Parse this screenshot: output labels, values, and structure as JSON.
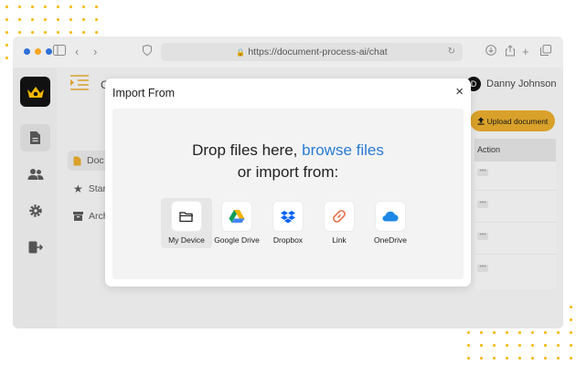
{
  "browser": {
    "url": "https://document-process-ai/chat",
    "traffic_colors": [
      "#2f6fd8",
      "#f5a623",
      "#2f6fd8"
    ]
  },
  "app": {
    "header_letter": "C",
    "user_initial": "D",
    "user_name": "Danny Johnson",
    "upload_label": "Upload document",
    "accent": "#d9a12a",
    "nav": [
      "Doc",
      "Star",
      "Arch"
    ],
    "table_header": "Action",
    "row_action": "•••"
  },
  "modal": {
    "title": "Import From",
    "close": "×",
    "drop_text_before": "Drop files here, ",
    "browse_link": "browse files",
    "drop_text_after": "or import from:",
    "link_color": "#2a7bd4",
    "sources": [
      {
        "label": "My Device",
        "icon": "folder-icon",
        "selected": true
      },
      {
        "label": "Google Drive",
        "icon": "google-drive-icon",
        "selected": false
      },
      {
        "label": "Dropbox",
        "icon": "dropbox-icon",
        "selected": false
      },
      {
        "label": "Link",
        "icon": "link-icon",
        "selected": false
      },
      {
        "label": "OneDrive",
        "icon": "onedrive-icon",
        "selected": false
      }
    ]
  }
}
